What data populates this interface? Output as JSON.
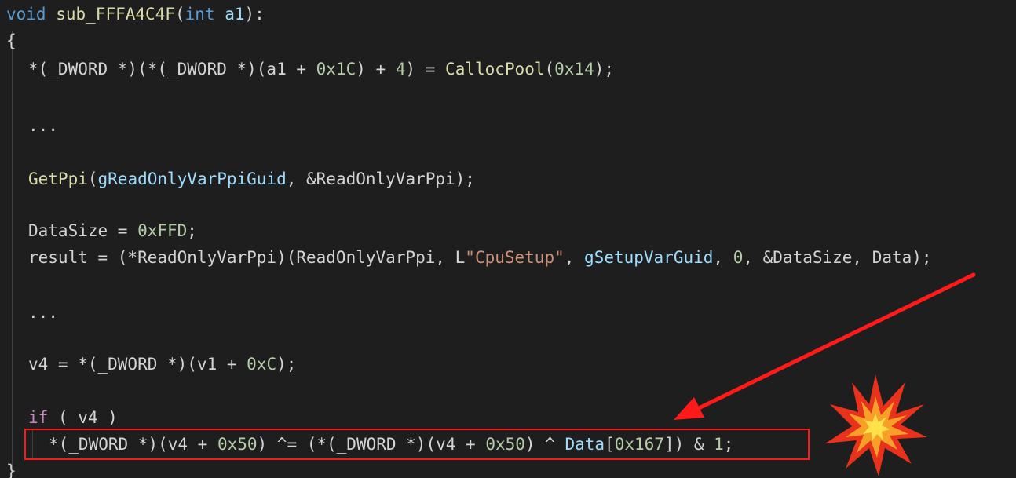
{
  "code": {
    "line1": {
      "kw_void": "void",
      "fname": "sub_FFFA4C4F",
      "paren_open": "(",
      "kw_int": "int",
      "param": "a1",
      "paren_close": "):"
    },
    "line2": {
      "brace": "{"
    },
    "line3": {
      "a": "*(_DWORD *)(*(_DWORD *)(a1 + ",
      "n1": "0x1C",
      "b": ") + ",
      "n2": "4",
      "c": ") = ",
      "fn": "CallocPool",
      "d": "(",
      "n3": "0x14",
      "e": ");"
    },
    "line4": {
      "ellipsis": "..."
    },
    "line5": {
      "fn": "GetPpi",
      "a": "(",
      "v1": "gReadOnlyVarPpiGuid",
      "b": ", &ReadOnlyVarPpi);"
    },
    "line6": {
      "a": "DataSize = ",
      "n": "0xFFD",
      "b": ";"
    },
    "line7": {
      "a": "result = (*ReadOnlyVarPpi)(ReadOnlyVarPpi, L",
      "s": "\"CpuSetup\"",
      "b": ", ",
      "v": "gSetupVarGuid",
      "c": ", ",
      "n": "0",
      "d": ", &DataSize, Data);"
    },
    "line8": {
      "ellipsis": "..."
    },
    "line9": {
      "a": "v4 = *(_DWORD *)(v1 + ",
      "n": "0xC",
      "b": ");"
    },
    "line10": {
      "kw": "if",
      "a": " ( v4 )"
    },
    "line11": {
      "a": "*(_DWORD *)(v4 + ",
      "n1": "0x50",
      "b": ") ^= (*(_DWORD *)(v4 + ",
      "n2": "0x50",
      "c": ") ^ ",
      "v": "Data",
      "d": "[",
      "n3": "0x167",
      "e": "]) & ",
      "n4": "1",
      "f": ";"
    },
    "line12": {
      "brace": "}"
    }
  },
  "colors": {
    "background": "#1e1e1e",
    "keyword": "#569cd6",
    "function": "#dcdcaa",
    "variable": "#9cdcfe",
    "number": "#b5cea8",
    "string": "#ce9178",
    "control": "#c586c0",
    "highlight": "#ff1a1a"
  },
  "icons": {
    "arrow": "red-arrow-icon",
    "explosion": "explosion-icon"
  }
}
